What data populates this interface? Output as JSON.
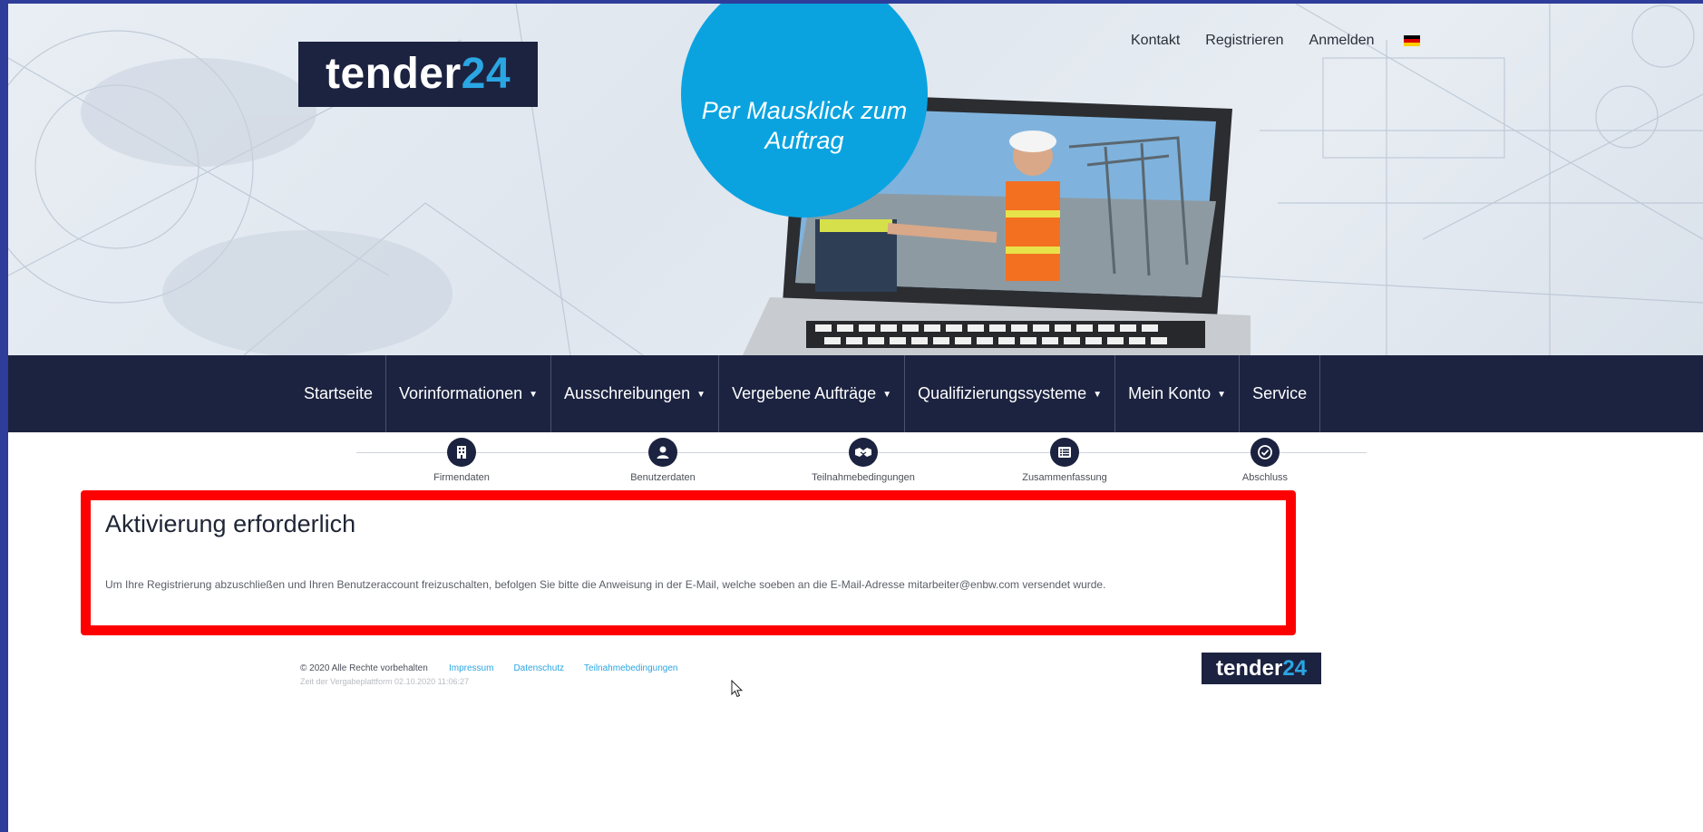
{
  "hero": {
    "logo_word": "tender",
    "logo_number": "24",
    "slogan": "Per Mausklick zum Auftrag",
    "topnav": [
      "Kontakt",
      "Registrieren",
      "Anmelden"
    ],
    "language_flag": "german-flag"
  },
  "mainnav": [
    {
      "label": "Startseite",
      "dropdown": false
    },
    {
      "label": "Vorinformationen",
      "dropdown": true
    },
    {
      "label": "Ausschreibungen",
      "dropdown": true
    },
    {
      "label": "Vergebene Aufträge",
      "dropdown": true
    },
    {
      "label": "Qualifizierungssysteme",
      "dropdown": true
    },
    {
      "label": "Mein Konto",
      "dropdown": true
    },
    {
      "label": "Service",
      "dropdown": false
    }
  ],
  "steps": [
    {
      "label": "Firmendaten",
      "icon": "building-icon"
    },
    {
      "label": "Benutzerdaten",
      "icon": "user-icon"
    },
    {
      "label": "Teilnahmebedingungen",
      "icon": "handshake-icon"
    },
    {
      "label": "Zusammenfassung",
      "icon": "list-icon"
    },
    {
      "label": "Abschluss",
      "icon": "check-circle-icon"
    }
  ],
  "alert": {
    "title": "Aktivierung erforderlich",
    "message": "Um Ihre Registrierung abzuschließen und Ihren Benutzeraccount freizuschalten, befolgen Sie bitte die Anweisung in der E-Mail, welche soeben an die E-Mail-Adresse mitarbeiter@enbw.com versendet wurde.",
    "border_color": "#ff0000"
  },
  "footer": {
    "copyright": "© 2020 Alle Rechte vorbehalten",
    "links": [
      "Impressum",
      "Datenschutz",
      "Teilnahmebedingungen"
    ],
    "time": "Zeit der Vergabeplattform 02.10.2020 11:06:27",
    "logo_word": "tender",
    "logo_number": "24"
  },
  "colors": {
    "brand_dark": "#1c2340",
    "brand_blue": "#0aa3e0",
    "link_blue": "#2aa6e3"
  }
}
